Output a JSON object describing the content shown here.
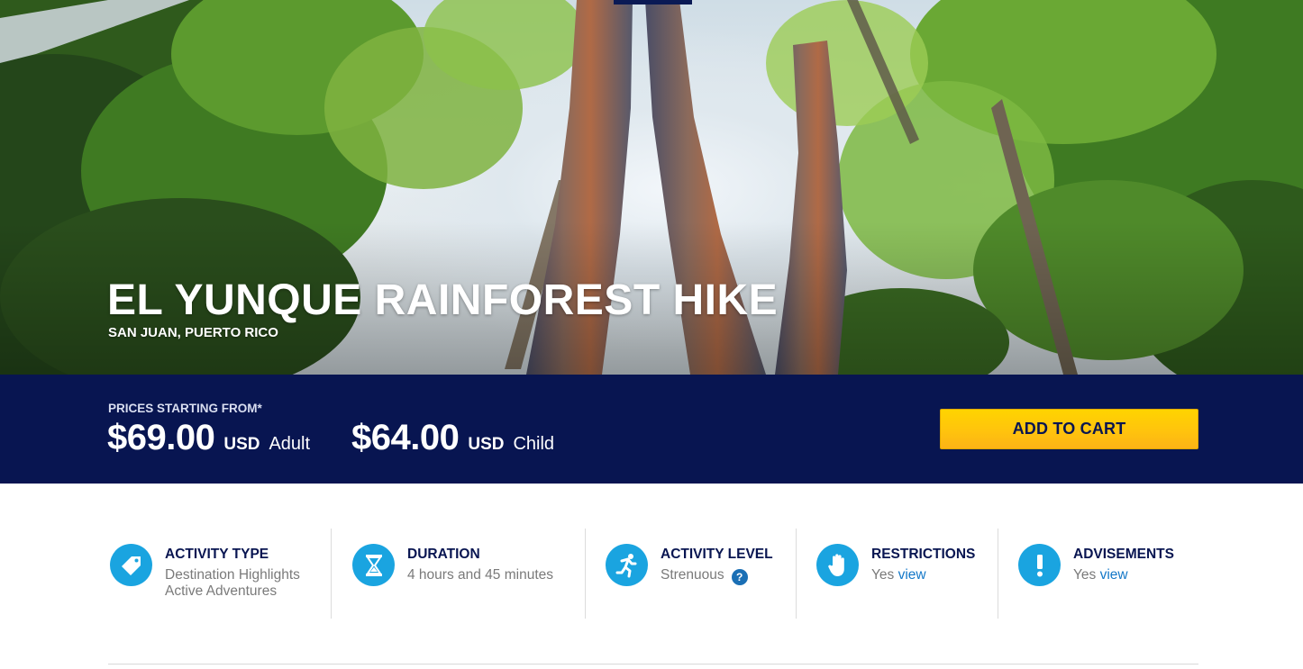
{
  "hero": {
    "title": "EL YUNQUE RAINFOREST HIKE",
    "location": "SAN JUAN, PUERTO RICO"
  },
  "pricing": {
    "label": "PRICES STARTING FROM*",
    "adult": {
      "amount": "$69.00",
      "currency": "USD",
      "type": "Adult"
    },
    "child": {
      "amount": "$64.00",
      "currency": "USD",
      "type": "Child"
    },
    "add_to_cart_label": "ADD TO CART"
  },
  "details": {
    "activity_type": {
      "heading": "ACTIVITY TYPE",
      "values": [
        "Destination Highlights",
        "Active Adventures"
      ],
      "icon": "tag-icon"
    },
    "duration": {
      "heading": "DURATION",
      "value": "4 hours and 45 minutes",
      "icon": "hourglass-icon"
    },
    "activity_level": {
      "heading": "ACTIVITY LEVEL",
      "value": "Strenuous",
      "help_symbol": "?",
      "icon": "runner-icon"
    },
    "restrictions": {
      "heading": "RESTRICTIONS",
      "value": "Yes",
      "link": "view",
      "icon": "hand-icon"
    },
    "advisements": {
      "heading": "ADVISEMENTS",
      "value": "Yes",
      "link": "view",
      "icon": "exclamation-icon"
    }
  },
  "colors": {
    "navy": "#081551",
    "accent_blue": "#1aa4e0",
    "cart_yellow": "#ffc20e",
    "link_blue": "#1478c8"
  }
}
